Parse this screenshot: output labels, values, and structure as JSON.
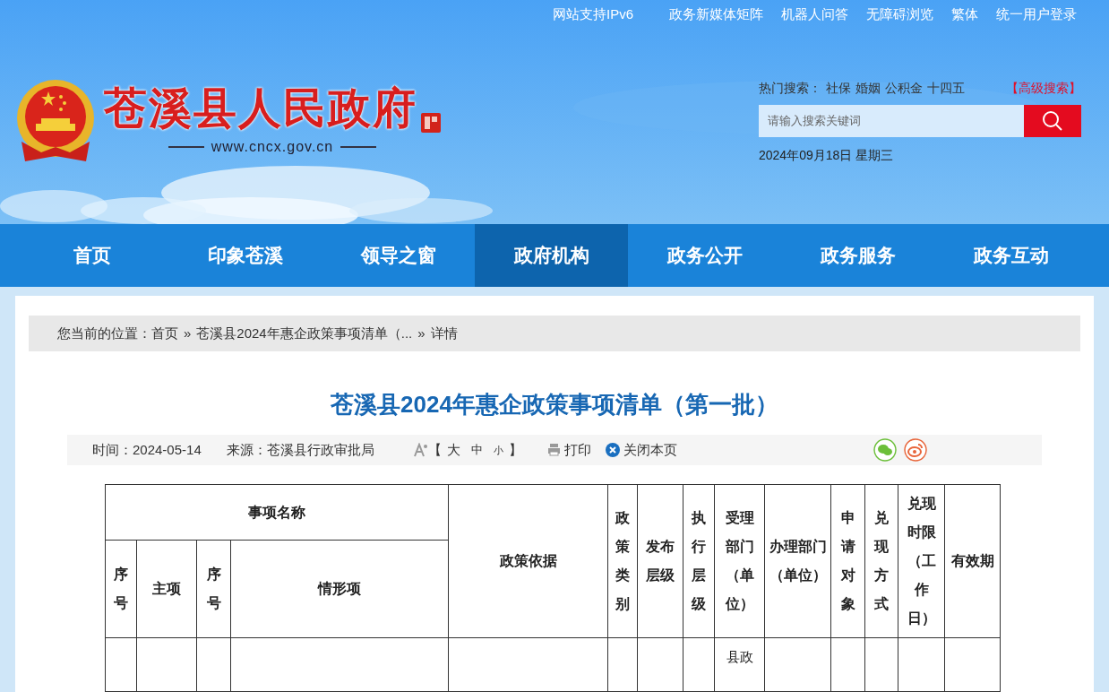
{
  "top_links": [
    "网站支持IPv6",
    "政务新媒体矩阵",
    "机器人问答",
    "无障碍浏览",
    "繁体",
    "统一用户登录"
  ],
  "site": {
    "name": "苍溪县人民政府",
    "url": "www.cncx.gov.cn"
  },
  "hot_search": {
    "label": "热门搜索：",
    "terms": [
      "社保",
      "婚姻",
      "公积金",
      "十四五"
    ],
    "advanced": "【高级搜索】"
  },
  "search": {
    "placeholder": "请输入搜索关键词"
  },
  "date": "2024年09月18日 星期三",
  "nav": [
    {
      "label": "首页",
      "selected": false
    },
    {
      "label": "印象苍溪",
      "selected": false
    },
    {
      "label": "领导之窗",
      "selected": false
    },
    {
      "label": "政府机构",
      "selected": true
    },
    {
      "label": "政务公开",
      "selected": false
    },
    {
      "label": "政务服务",
      "selected": false
    },
    {
      "label": "政务互动",
      "selected": false
    }
  ],
  "breadcrumb": {
    "label": "您当前的位置：",
    "separator": "»",
    "items": [
      "首页",
      "苍溪县2024年惠企政策事项清单（...",
      "详情"
    ]
  },
  "article": {
    "title": "苍溪县2024年惠企政策事项清单（第一批）",
    "time": "时间：2024-05-14",
    "source": "来源：苍溪县行政审批局",
    "font_bracket_open": "【",
    "font_sizes": [
      "大",
      "中",
      "小"
    ],
    "font_bracket_close": "】",
    "print": "打印",
    "close": "关闭本页"
  },
  "table": {
    "group_header": "事项名称",
    "columns": [
      "序号",
      "主项",
      "序号",
      "情形项",
      "政策依据",
      "政策类别",
      "发布层级",
      "执行层级",
      "受理部门（单位）",
      "办理部门（单位）",
      "申请对象",
      "兑现方式",
      "兑现时限（工作日）",
      "有效期"
    ],
    "rows": [
      [
        "",
        "",
        "",
        "",
        "",
        "",
        "",
        "",
        "县政",
        "",
        "",
        "",
        "",
        ""
      ]
    ]
  }
}
